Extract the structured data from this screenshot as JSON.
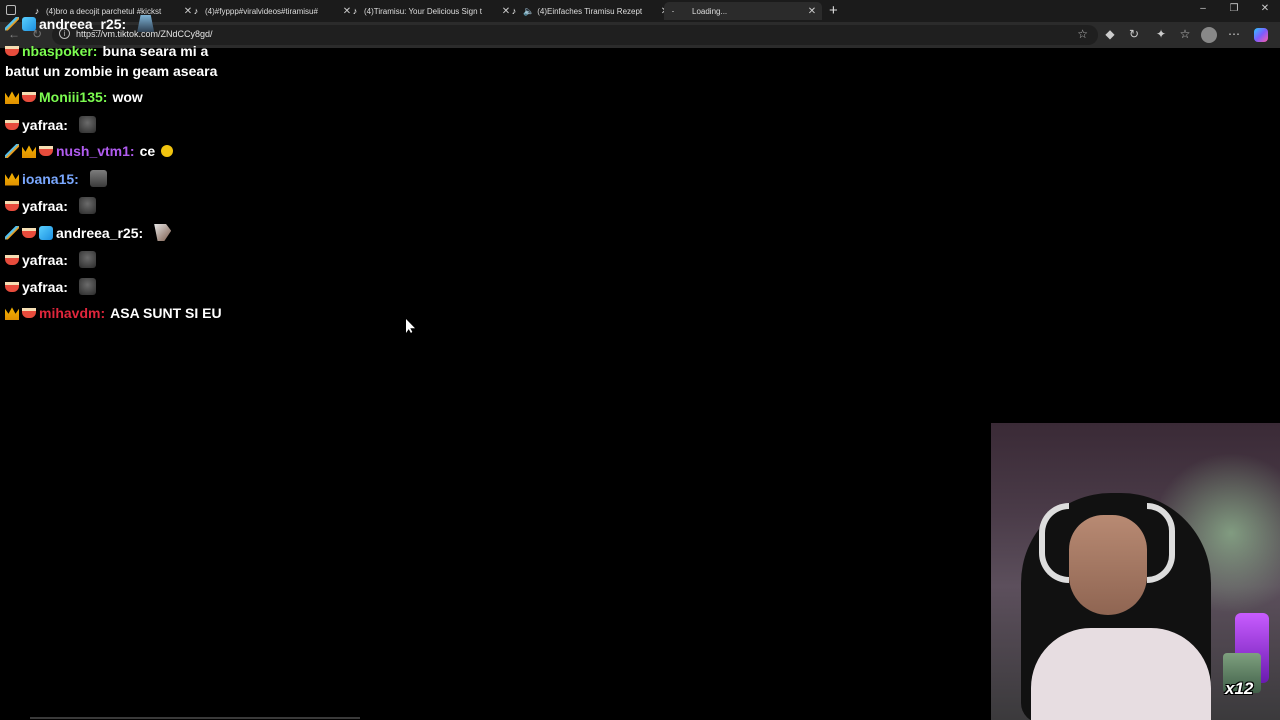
{
  "browser": {
    "tabs": [
      {
        "title": "(4)bro a decojit parchetul #kickst",
        "active": false,
        "muted_icon": false
      },
      {
        "title": "(4)#fyppp#viralvideos#tiramisu#",
        "active": false,
        "muted_icon": false
      },
      {
        "title": "(4)Tiramisu: Your Delicious Sign t",
        "active": false,
        "muted_icon": false
      },
      {
        "title": "(4)Einfaches Tiramisu Rezept",
        "active": false,
        "muted_icon": true
      },
      {
        "title": "Loading...",
        "active": true,
        "muted_icon": false
      }
    ],
    "new_tab_label": "+",
    "address": "https://vm.tiktok.com/ZNdCCy8gd/",
    "window_controls": {
      "minimize": "–",
      "restore": "❐",
      "close": "✕"
    }
  },
  "chat": {
    "messages": [
      {
        "badges": [
          "sword",
          "cube"
        ],
        "user": "andreea_r25:",
        "user_color": "#ffffff",
        "text": "",
        "emote": "blue"
      },
      {
        "badges": [
          "cup"
        ],
        "user": "nbaspoker:",
        "user_color": "#7cfc50",
        "text": "buna seara mi a",
        "emote": ""
      },
      {
        "badges": [],
        "user": "",
        "user_color": "#ffffff",
        "text": "batut un zombie in geam aseara",
        "emote": ""
      },
      {
        "badges": [
          "crown",
          "cup"
        ],
        "user": "Moniii135:",
        "user_color": "#7cfc50",
        "text": "wow",
        "emote": ""
      },
      {
        "badges": [
          "cup"
        ],
        "user": "yafraa:",
        "user_color": "#ffffff",
        "text": "",
        "emote": "gray"
      },
      {
        "badges": [
          "sword",
          "crown",
          "cup"
        ],
        "user": "nush_vtm1:",
        "user_color": "#b15cf0",
        "text": "ce",
        "emote": "ball"
      },
      {
        "badges": [
          "crown"
        ],
        "user": "ioana15:",
        "user_color": "#7aa8ff",
        "text": "",
        "emote": "cat"
      },
      {
        "badges": [
          "cup"
        ],
        "user": "yafraa:",
        "user_color": "#ffffff",
        "text": "",
        "emote": "gray"
      },
      {
        "badges": [
          "sword",
          "cup",
          "cube"
        ],
        "user": "andreea_r25:",
        "user_color": "#ffffff",
        "text": "",
        "emote": "hammer"
      },
      {
        "badges": [
          "cup"
        ],
        "user": "yafraa:",
        "user_color": "#ffffff",
        "text": "",
        "emote": "gray"
      },
      {
        "badges": [
          "cup"
        ],
        "user": "yafraa:",
        "user_color": "#ffffff",
        "text": "",
        "emote": "gray"
      },
      {
        "badges": [
          "crown",
          "cup"
        ],
        "user": "mihavdm:",
        "user_color": "#e0263c",
        "text": "ASA SUNT SI EU",
        "emote": ""
      }
    ]
  },
  "webcam": {
    "gift_multiplier": "x12"
  }
}
